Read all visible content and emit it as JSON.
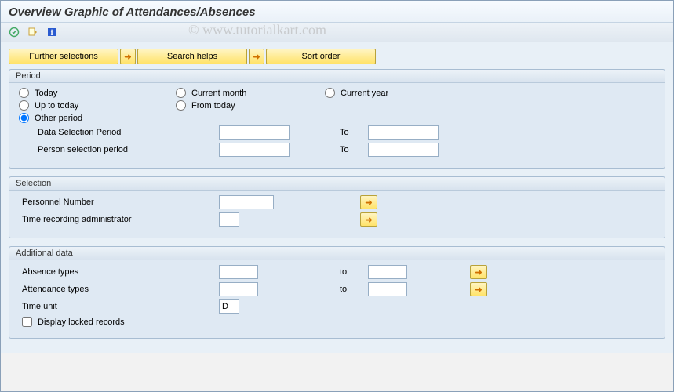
{
  "title": "Overview Graphic of Attendances/Absences",
  "watermark": "© www.tutorialkart.com",
  "buttons": {
    "further_selections": "Further selections",
    "search_helps": "Search helps",
    "sort_order": "Sort order"
  },
  "period": {
    "title": "Period",
    "today": "Today",
    "current_month": "Current month",
    "current_year": "Current year",
    "up_to_today": "Up to today",
    "from_today": "From today",
    "other_period": "Other period",
    "data_sel_label": "Data Selection Period",
    "person_sel_label": "Person selection period",
    "to": "To",
    "data_sel_from": "",
    "data_sel_to": "",
    "person_sel_from": "",
    "person_sel_to": ""
  },
  "selection": {
    "title": "Selection",
    "personnel_number": "Personnel Number",
    "time_admin": "Time recording administrator",
    "pn_value": "",
    "ta_value": ""
  },
  "additional": {
    "title": "Additional data",
    "absence_types": "Absence types",
    "attendance_types": "Attendance types",
    "time_unit": "Time unit",
    "display_locked": "Display locked records",
    "to": "to",
    "abs_from": "",
    "abs_to": "",
    "att_from": "",
    "att_to": "",
    "time_unit_value": "D"
  }
}
